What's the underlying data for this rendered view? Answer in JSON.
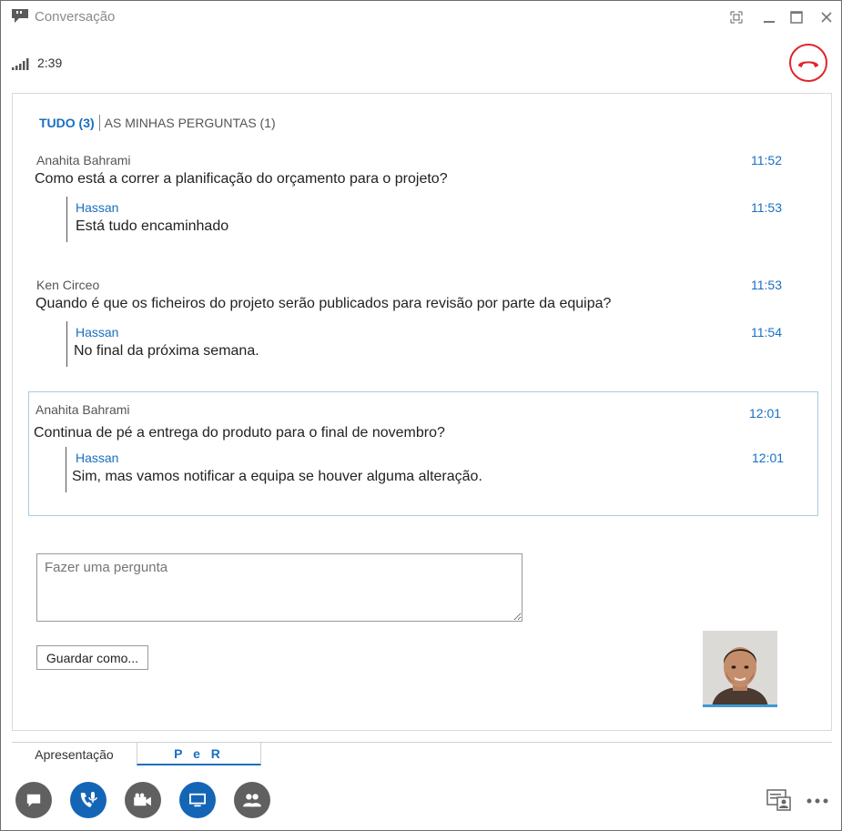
{
  "window": {
    "title": "Conversação"
  },
  "call": {
    "duration": "2:39"
  },
  "qa": {
    "tab_all": "TUDO (3)",
    "tab_mine": "AS MINHAS PERGUNTAS (1)",
    "questions": [
      {
        "author": "Anahita Bahrami",
        "text": "Como está a correr a planificação do orçamento para o projeto?",
        "time": "11:52",
        "reply": {
          "author": "Hassan",
          "text": "Está tudo encaminhado",
          "time": "11:53"
        }
      },
      {
        "author": "Ken Circeo",
        "text": "Quando é que os ficheiros do projeto serão publicados para revisão por parte da equipa?",
        "time": "11:53",
        "reply": {
          "author": "Hassan",
          "text": "No final da próxima semana.",
          "time": "11:54"
        }
      },
      {
        "author": "Anahita Bahrami",
        "text": "Continua de pé a entrega do produto para o final de novembro?",
        "time": "12:01",
        "reply": {
          "author": "Hassan",
          "text": "Sim, mas vamos notificar a equipa se houver alguma alteração.",
          "time": "12:01"
        }
      }
    ],
    "ask_placeholder": "Fazer uma pergunta",
    "save_label": "Guardar como..."
  },
  "bottom_tabs": {
    "presentation": "Apresentação",
    "qa": "P e R"
  },
  "colors": {
    "accent": "#1a6fc0",
    "hangup": "#e0252b",
    "toolbar_grey": "#606060",
    "toolbar_blue": "#1565b6"
  },
  "icons": {
    "title": "conversation-icon",
    "toolbar": [
      "chat-icon",
      "call-mic-icon",
      "video-icon",
      "present-icon",
      "participants-icon"
    ],
    "right": [
      "contact-card-icon",
      "more-options-icon"
    ]
  }
}
